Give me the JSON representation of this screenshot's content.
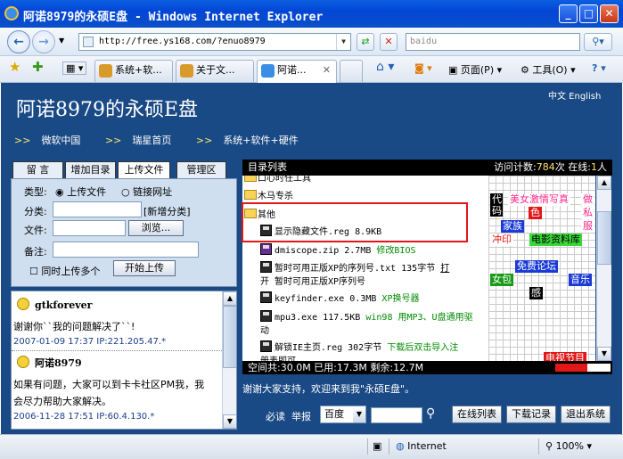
{
  "window": {
    "title": "阿诺8979的永硕E盘 - Windows Internet Explorer",
    "minimize": "_",
    "maximize": "□",
    "close": "✕"
  },
  "navbar": {
    "back": "←",
    "forward": "→",
    "url": "http://free.ys168.com/?enuo8979",
    "search_placeholder": "baidu"
  },
  "tabs": [
    {
      "label": "系统+软...",
      "active": false
    },
    {
      "label": "关于文...",
      "active": false
    },
    {
      "label": "阿诺...",
      "active": true
    }
  ],
  "toolbar": {
    "page_menu": "页面(P)",
    "tools_menu": "工具(O)",
    "help_menu": "?"
  },
  "site": {
    "title": "阿诺8979的永硕E盘",
    "lang": "中文 English",
    "nav": [
      {
        "prefix": ">>",
        "label": "微软中国"
      },
      {
        "prefix": ">>",
        "label": "瑞星首页"
      },
      {
        "prefix": ">>",
        "label": "系统+软件+硬件"
      }
    ]
  },
  "left_tabs": [
    "留 言",
    "增加目录",
    "上传文件",
    "管理区"
  ],
  "upload_form": {
    "type_label": "类型:",
    "type_upload": "上传文件",
    "type_link": "链接网址",
    "category_label": "分类:",
    "new_category": "[新增分类]",
    "file_label": "文件:",
    "browse": "浏览...",
    "note_label": "备注:",
    "multi_upload": "同时上传多个",
    "start_upload": "开始上传"
  },
  "messages": [
    {
      "name": "gtkforever",
      "text": [
        "谢谢你``我的问题解决了``!"
      ],
      "time": "2007-01-09 17:37 IP:221.205.47.*"
    },
    {
      "name": "阿诺8979",
      "text": [
        "如果有问题，大家可以到卡卡社区PM我，我",
        "会尽力帮助大家解决。"
      ],
      "time": "2006-11-28 17:51 IP:60.4.130.*"
    }
  ],
  "file_panel": {
    "header_title": "目录列表",
    "visit_label": "访问计数:",
    "visit_count": "784",
    "visit_unit": "次",
    "online_label": "在线:",
    "online_count": "1",
    "online_unit": "人",
    "items": [
      {
        "kind": "folder",
        "name": "口心时任工具",
        "desc": ""
      },
      {
        "kind": "folder",
        "name": "木马专杀",
        "desc": ""
      },
      {
        "kind": "folder",
        "name": "其他",
        "desc": ""
      },
      {
        "kind": "file",
        "name": "显示隐藏文件.reg 8.9KB",
        "desc": ""
      },
      {
        "kind": "file",
        "name": "dmiscope.zip 2.7MB",
        "desc": "修改BIOS"
      },
      {
        "kind": "file",
        "name": "暂时可用正版XP的序列号.txt 135字节",
        "desc": "打"
      },
      {
        "kind": "file",
        "name": "开 暂时可用正版XP序列号",
        "desc": ""
      },
      {
        "kind": "file",
        "name": "keyfinder.exe 0.3MB",
        "desc": "XP换号器"
      },
      {
        "kind": "file",
        "name": "mpu3.exe 117.5KB",
        "desc": "win98 用MP3、U盘通用驱"
      },
      {
        "kind": "file",
        "name": "动",
        "desc": ""
      },
      {
        "kind": "file",
        "name": "解锁IE主页.reg 302字节",
        "desc": "下载后双击导入注"
      },
      {
        "kind": "file",
        "name": "册表即可",
        "desc": ""
      }
    ],
    "space": "空间共:30.0M 已用:17.3M 剩余:12.7M",
    "space_used_fraction": 0.577,
    "welcome": "谢谢大家支持，欢迎来到我\"永硕E盘\"。"
  },
  "ads": [
    {
      "text": "代码",
      "color": "#ffffff",
      "bg": "#000000"
    },
    {
      "text": "美女激情写真",
      "color": "#ff2a8a",
      "bg": "#ffffff"
    },
    {
      "text": "做",
      "color": "#ff2a8a",
      "bg": "#ffffff"
    },
    {
      "text": "色",
      "color": "#ffffff",
      "bg": "#e01818"
    },
    {
      "text": "私",
      "color": "#ff2a8a",
      "bg": "#ffffff"
    },
    {
      "text": "家族",
      "color": "#ffffff",
      "bg": "#1a3ad6"
    },
    {
      "text": "服",
      "color": "#ff2a8a",
      "bg": "#ffffff"
    },
    {
      "text": "冲印",
      "color": "#e01818",
      "bg": "#ffffff"
    },
    {
      "text": "电影资料库",
      "color": "#000000",
      "bg": "#3ad63a"
    },
    {
      "text": "免费论坛",
      "color": "#ffffff",
      "bg": "#1a3ad6"
    },
    {
      "text": "女包",
      "color": "#ffffff",
      "bg": "#1a9a1a"
    },
    {
      "text": "音乐",
      "color": "#ffffff",
      "bg": "#1a3ad6"
    },
    {
      "text": "感",
      "color": "#ffffff",
      "bg": "#000000"
    },
    {
      "text": "电视节目",
      "color": "#ffffff",
      "bg": "#e01818"
    }
  ],
  "bottom": {
    "must_read": "必读",
    "report": "举报",
    "engine": "百度",
    "online_list": "在线列表",
    "download_log": "下载记录",
    "logout": "退出系统"
  },
  "status": {
    "zone": "Internet",
    "zoom": "100%"
  }
}
